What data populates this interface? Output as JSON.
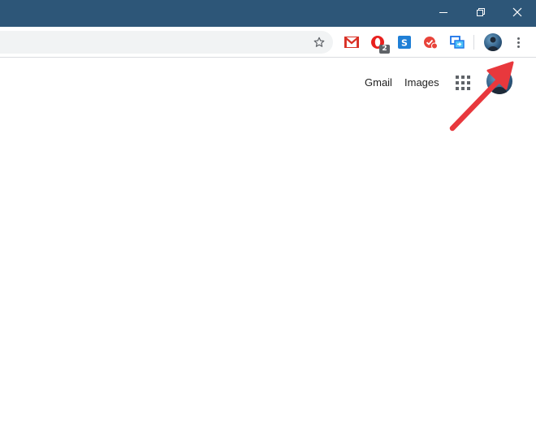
{
  "colors": {
    "titlebar": "#2d5678",
    "toolbar": "#ffffff",
    "omnibox": "#f1f3f4",
    "annotation_arrow": "#e8383d"
  },
  "window_controls": [
    {
      "name": "minimize-icon"
    },
    {
      "name": "restore-icon"
    },
    {
      "name": "close-icon"
    }
  ],
  "extensions": [
    {
      "name": "gmail-extension-icon"
    },
    {
      "name": "opera-extension-icon",
      "badge": "2"
    },
    {
      "name": "skype-extension-icon"
    },
    {
      "name": "todo-extension-icon"
    },
    {
      "name": "screen-capture-extension-icon"
    }
  ],
  "google_header": {
    "gmail": "Gmail",
    "images": "Images"
  }
}
